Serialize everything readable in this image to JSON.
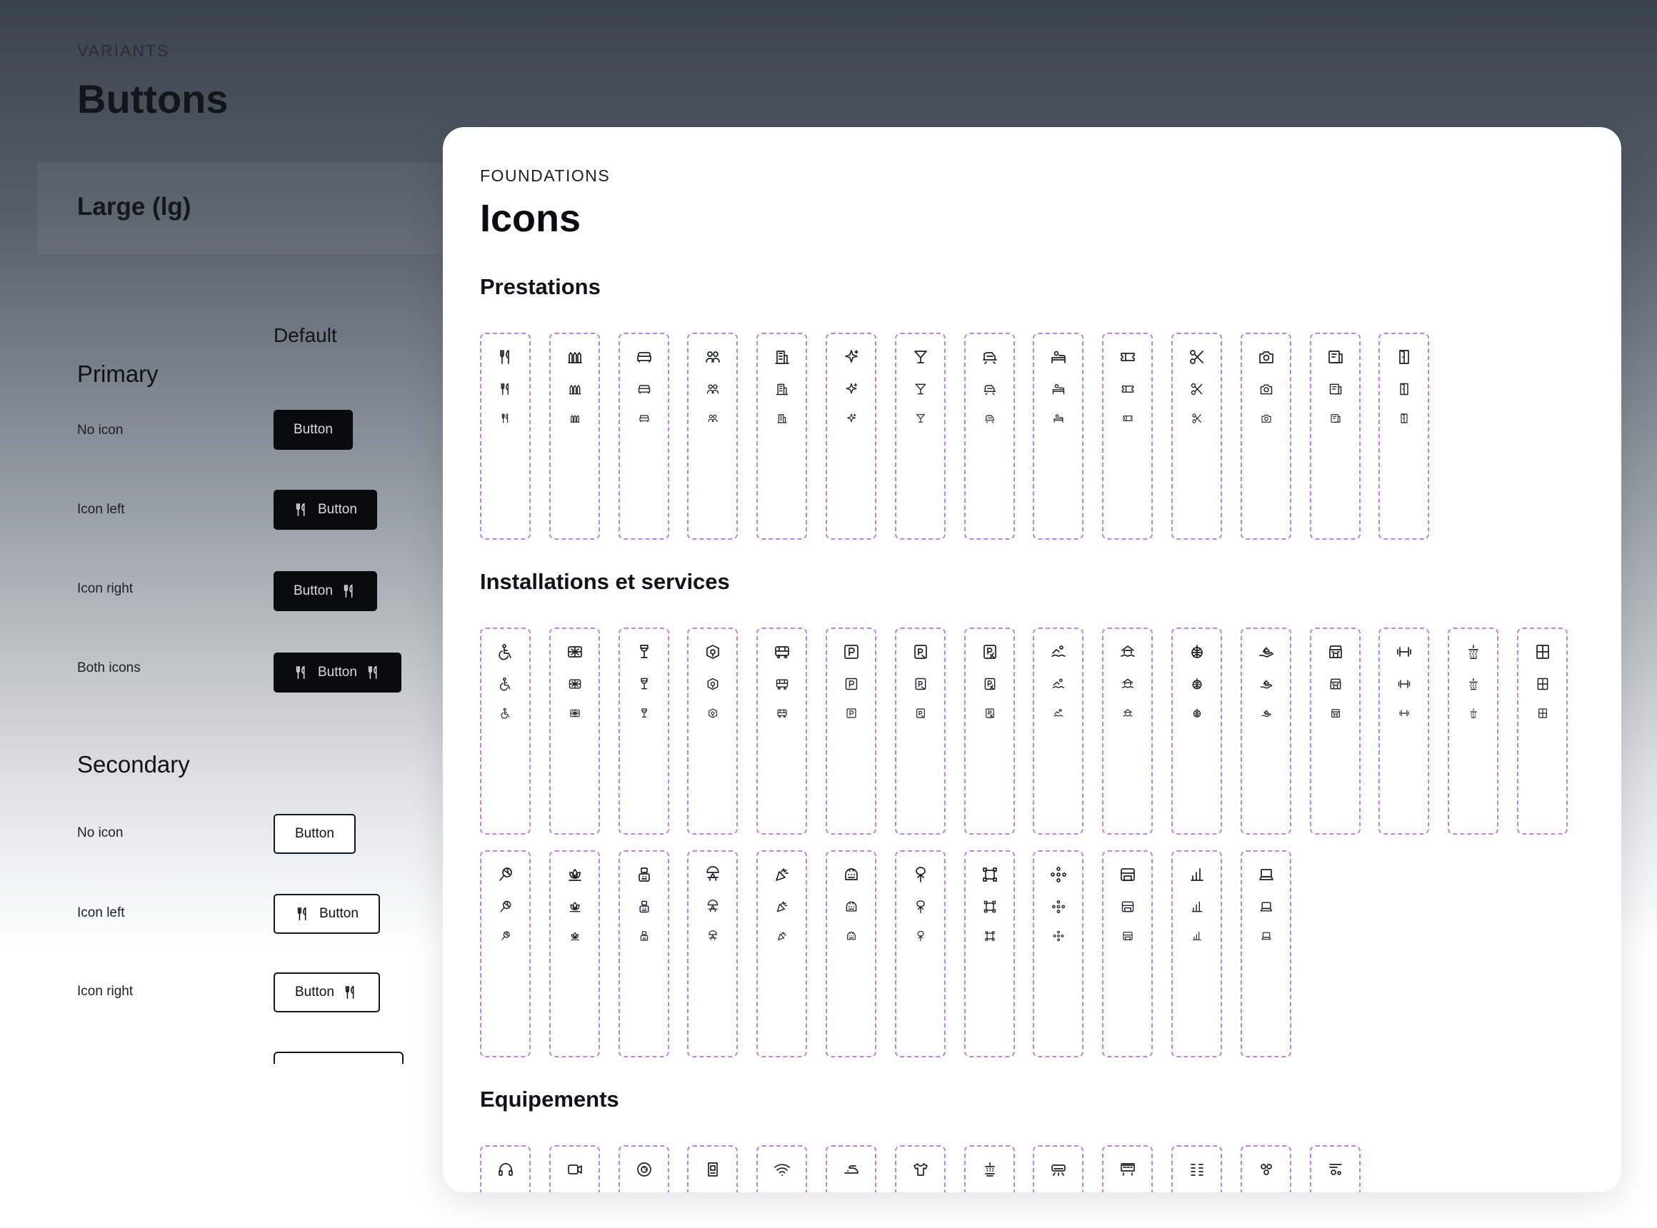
{
  "back": {
    "eyebrow": "VARIANTS",
    "title": "Buttons",
    "size_label": "Large (lg)",
    "column_header": "Default",
    "groups": [
      {
        "title": "Primary",
        "rows": [
          {
            "label": "No icon",
            "button": "Button",
            "icon_left": false,
            "icon_right": false
          },
          {
            "label": "Icon left",
            "button": "Button",
            "icon_left": true,
            "icon_right": false
          },
          {
            "label": "Icon right",
            "button": "Button",
            "icon_left": false,
            "icon_right": true
          },
          {
            "label": "Both icons",
            "button": "Button",
            "icon_left": true,
            "icon_right": true
          }
        ]
      },
      {
        "title": "Secondary",
        "rows": [
          {
            "label": "No icon",
            "button": "Button",
            "icon_left": false,
            "icon_right": false
          },
          {
            "label": "Icon left",
            "button": "Button",
            "icon_left": true,
            "icon_right": false
          },
          {
            "label": "Icon right",
            "button": "Button",
            "icon_left": false,
            "icon_right": true
          }
        ]
      }
    ],
    "button_icon": "utensils-icon"
  },
  "front": {
    "eyebrow": "FOUNDATIONS",
    "title": "Icons",
    "sections": [
      {
        "title": "Prestations",
        "rows": [
          [
            "utensils-icon",
            "buffet-icon",
            "sofa-icon",
            "group-icon",
            "hotel-building-icon",
            "sparkles-icon",
            "cocktail-icon",
            "train-icon",
            "bed-person-icon",
            "ticket-icon",
            "scissors-icon",
            "camera-icon",
            "catalog-icon",
            "door-icon"
          ]
        ]
      },
      {
        "title": "Installations et services",
        "rows": [
          [
            "wheelchair-icon",
            "globe-sign-icon",
            "wine-glass-icon",
            "terrace-icon",
            "bus-icon",
            "parking-icon",
            "parking-sign-icon",
            "parking-alt-icon",
            "swimming-icon",
            "pool-icon",
            "disco-ball-icon",
            "hand-service-icon",
            "shop-icon",
            "dumbbell-icon",
            "shower-icon",
            "window-icon"
          ],
          [
            "tennis-icon",
            "spa-icon",
            "robot-icon",
            "kids-club-icon",
            "party-icon",
            "sauna-icon",
            "garden-icon",
            "frame-icon",
            "atom-icon",
            "store-icon",
            "chart-icon",
            "laptop-icon"
          ]
        ]
      },
      {
        "title": "Equipements",
        "rows": [
          [
            "headphones-icon",
            "video-camera-icon",
            "safe-icon",
            "phone-booth-icon",
            "wifi-icon",
            "iron-icon",
            "tshirt-icon",
            "heater-icon",
            "air-conditioner-icon",
            "minibar-icon",
            "grid-icon",
            "dots-icon",
            "kettle-icon"
          ]
        ]
      }
    ]
  },
  "colors": {
    "cell_border": "#c07ef0",
    "primary_button": "#0a0b0e",
    "card": "#ffffff"
  }
}
